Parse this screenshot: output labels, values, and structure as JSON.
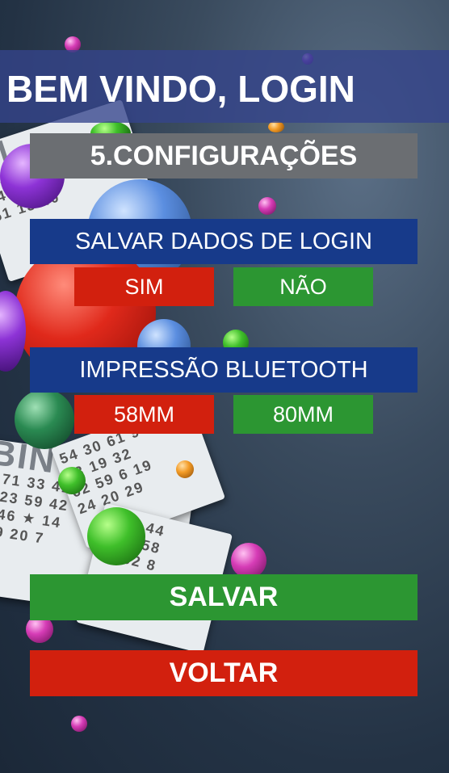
{
  "header": {
    "title": "BEM VINDO, LOGIN"
  },
  "section": {
    "title": "5.CONFIGURAÇÕES"
  },
  "login_settings": {
    "label": "SALVAR DADOS DE LOGIN",
    "option_yes": "SIM",
    "option_no": "NÃO"
  },
  "bluetooth_settings": {
    "label": "IMPRESSÃO BLUETOOTH",
    "option_58": "58MM",
    "option_80": "80MM"
  },
  "actions": {
    "save": "SALVAR",
    "back": "VOLTAR"
  },
  "colors": {
    "header_band": "#34448c",
    "section_bar": "#6b6e72",
    "group_label": "#173a8a",
    "red": "#d2200e",
    "green": "#2c9632"
  }
}
